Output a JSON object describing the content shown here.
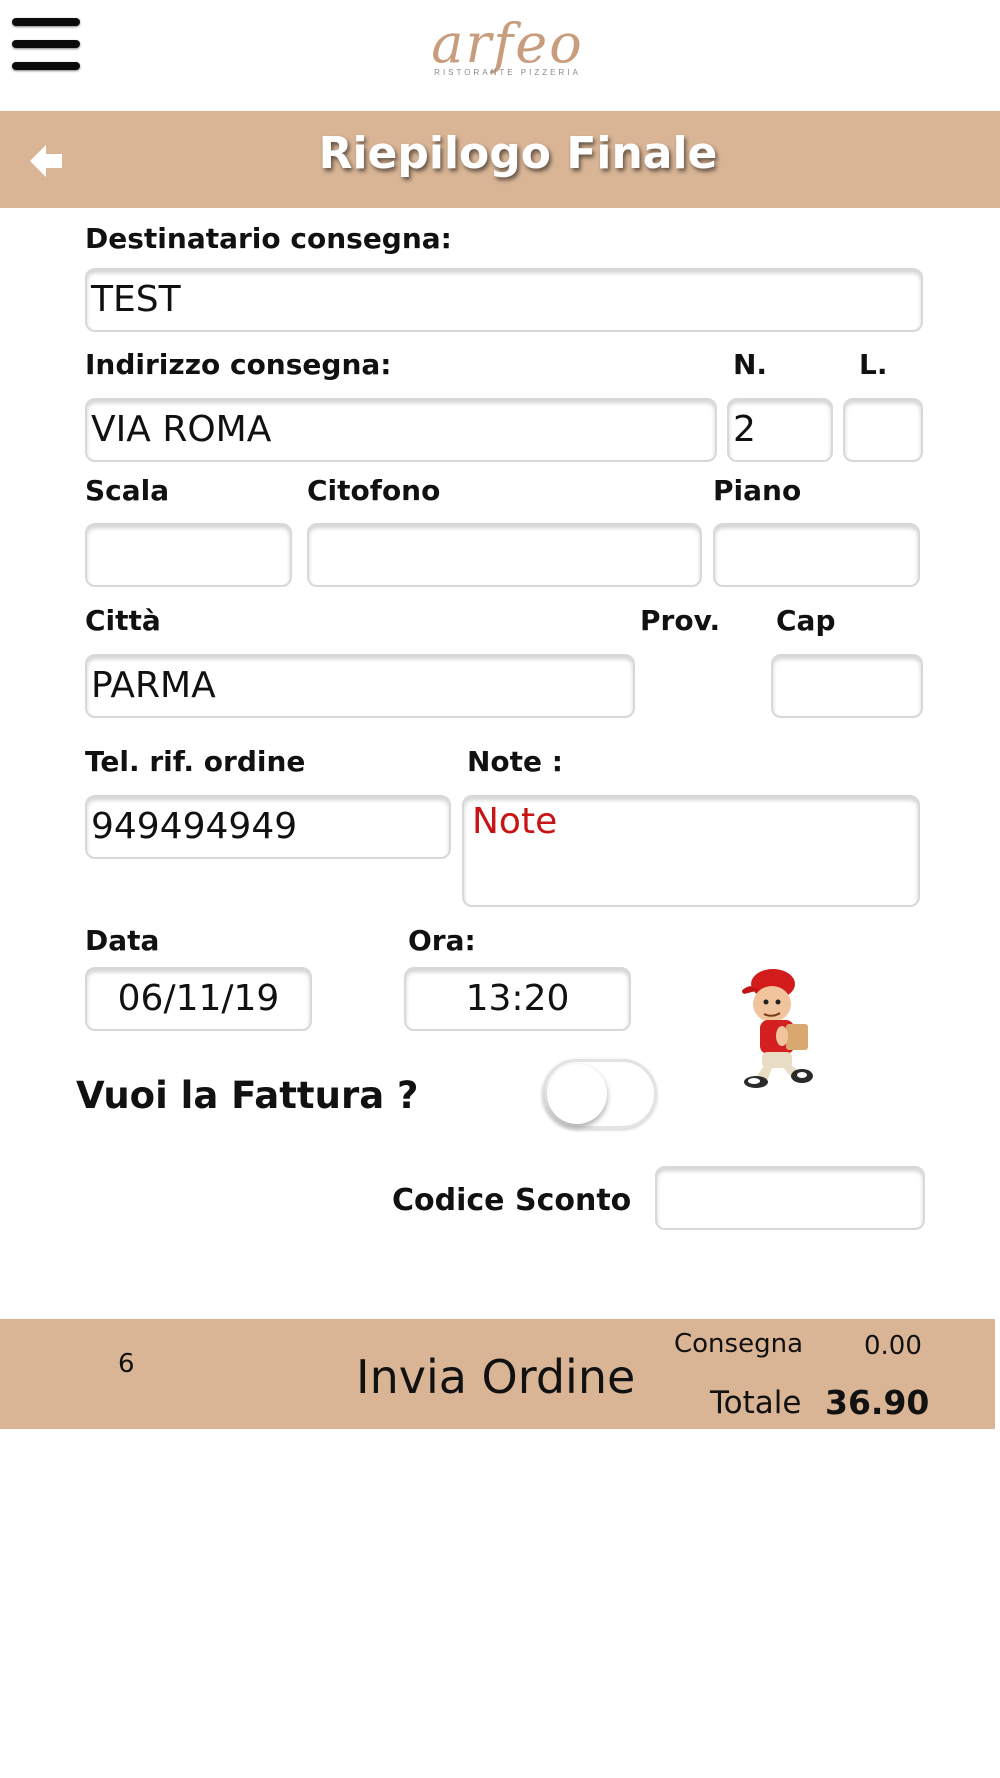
{
  "logo": {
    "word": "arfeo",
    "subtitle": "RISTORANTE PIZZERIA"
  },
  "header": {
    "title": "Riepilogo Finale"
  },
  "form": {
    "recipient_label": "Destinatario consegna:",
    "recipient_value": "TEST",
    "address_label": "Indirizzo consegna:",
    "address_value": "VIA ROMA",
    "number_label": "N.",
    "number_value": "2",
    "letter_label": "L.",
    "letter_value": "",
    "stair_label": "Scala",
    "stair_value": "",
    "intercom_label": "Citofono",
    "intercom_value": "",
    "floor_label": "Piano",
    "floor_value": "",
    "city_label": "Città",
    "city_value": "PARMA",
    "province_label": "Prov.",
    "zip_label": "Cap",
    "zip_value": "",
    "phone_label": "Tel. rif. ordine",
    "phone_value": "949494949",
    "notes_label": "Note :",
    "notes_placeholder": "Note",
    "date_label": "Data",
    "date_value": "06/11/19",
    "time_label": "Ora:",
    "time_value": "13:20",
    "invoice_label": "Vuoi la Fattura ?",
    "invoice_on": false,
    "discount_label": "Codice Sconto",
    "discount_value": ""
  },
  "footer": {
    "count": "6",
    "send_label": "Invia Ordine",
    "delivery_label": "Consegna",
    "delivery_value": "0.00",
    "total_label": "Totale",
    "total_value": "36.90"
  },
  "colors": {
    "brand_tan": "#d9b596",
    "note_red": "#c81414"
  },
  "icons": [
    "hamburger-menu-icon",
    "back-arrow-icon",
    "delivery-man-icon"
  ]
}
